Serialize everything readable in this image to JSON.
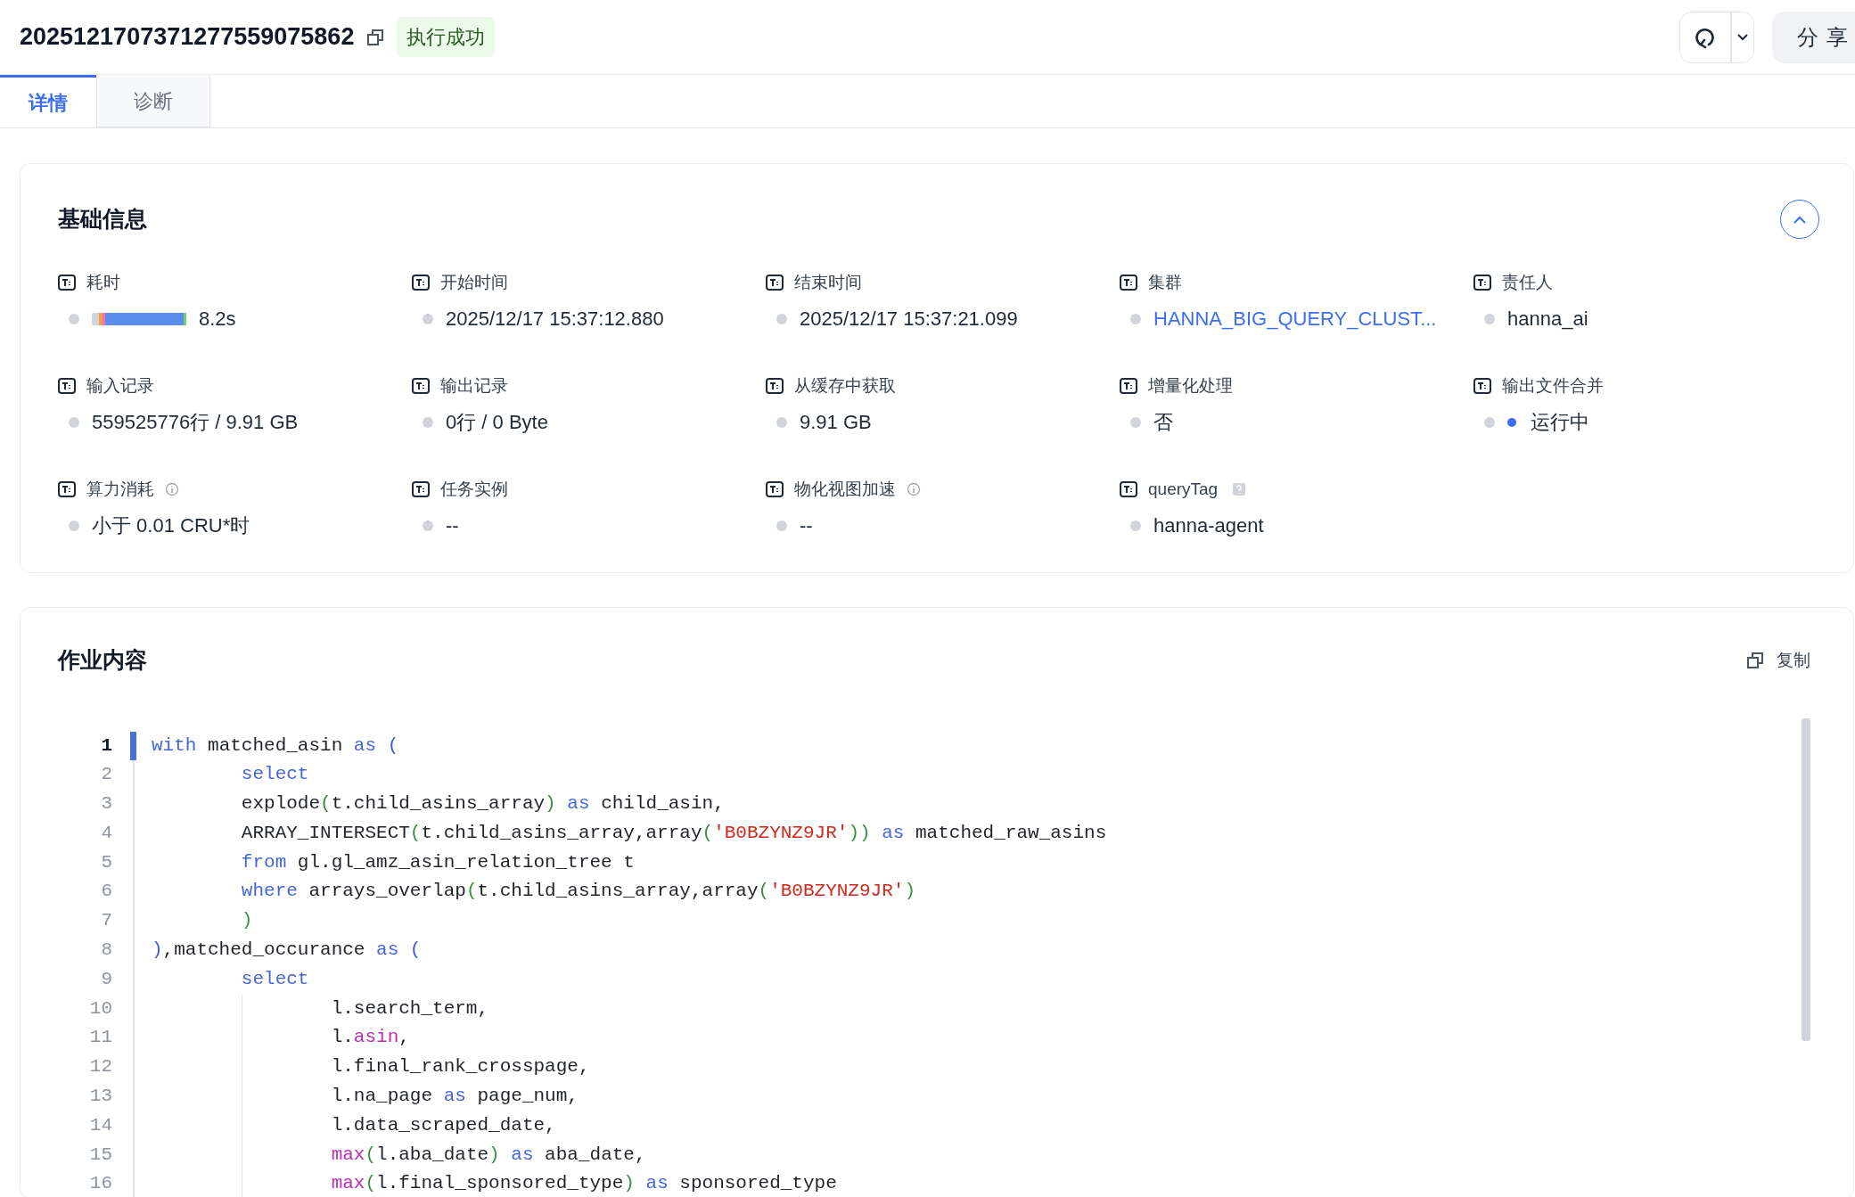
{
  "header": {
    "title": "2025121707371277559075862",
    "status_badge": "执行成功",
    "share_button": "分享"
  },
  "tabs": [
    {
      "label": "详情",
      "selected": true
    },
    {
      "label": "诊断",
      "selected": false
    }
  ],
  "basic_info": {
    "title": "基础信息",
    "expanded": true,
    "fields": [
      {
        "label": "耗时",
        "kind": "duration",
        "value": "8.2s"
      },
      {
        "label": "开始时间",
        "kind": "text",
        "value": "2025/12/17 15:37:12.880"
      },
      {
        "label": "结束时间",
        "kind": "text",
        "value": "2025/12/17 15:37:21.099"
      },
      {
        "label": "集群",
        "kind": "link",
        "value": "HANNA_BIG_QUERY_CLUST..."
      },
      {
        "label": "责任人",
        "kind": "text",
        "value": "hanna_ai"
      },
      {
        "label": "输入记录",
        "kind": "text",
        "value": "559525776行 / 9.91 GB"
      },
      {
        "label": "输出记录",
        "kind": "text",
        "value": "0行 / 0 Byte"
      },
      {
        "label": "从缓存中获取",
        "kind": "text",
        "value": "9.91 GB"
      },
      {
        "label": "增量化处理",
        "kind": "text",
        "value": "否"
      },
      {
        "label": "输出文件合并",
        "kind": "status",
        "value": "运行中"
      },
      {
        "label": "算力消耗",
        "kind": "text",
        "info_icon": true,
        "value": "小于 0.01 CRU*时"
      },
      {
        "label": "任务实例",
        "kind": "text",
        "value": "--"
      },
      {
        "label": "物化视图加速",
        "kind": "text",
        "info_icon": true,
        "value": "--"
      },
      {
        "label": "queryTag",
        "kind": "text",
        "help_icon": true,
        "value": "hanna-agent"
      }
    ]
  },
  "job_content": {
    "title": "作业内容",
    "copy_label": "复制",
    "code_lines": [
      {
        "number": "1",
        "selected": true,
        "tokens": [
          {
            "kind": "keyword",
            "text": "with"
          },
          {
            "kind": "plain",
            "text": " matched_asin"
          },
          {
            "kind": "keyword",
            "text": " as"
          },
          {
            "kind": "bracket",
            "text": " ("
          }
        ]
      },
      {
        "number": "2",
        "selected": false,
        "tokens": [
          {
            "kind": "keyword",
            "text": "\tselect"
          }
        ]
      },
      {
        "number": "3",
        "selected": false,
        "tokens": [
          {
            "kind": "plain",
            "text": "\texplode"
          },
          {
            "kind": "paren",
            "text": "("
          },
          {
            "kind": "plain",
            "text": "t.child_asins_array"
          },
          {
            "kind": "paren",
            "text": ")"
          },
          {
            "kind": "keyword",
            "text": " as"
          },
          {
            "kind": "plain",
            "text": " child_asin,"
          }
        ]
      },
      {
        "number": "4",
        "selected": false,
        "tokens": [
          {
            "kind": "plain",
            "text": "\tARRAY_INTERSECT"
          },
          {
            "kind": "paren",
            "text": "("
          },
          {
            "kind": "plain",
            "text": "t.child_asins_array,array"
          },
          {
            "kind": "paren",
            "text": "("
          },
          {
            "kind": "string",
            "text": "'B0BZYNZ9JR'"
          },
          {
            "kind": "paren",
            "text": "))"
          },
          {
            "kind": "keyword",
            "text": " as"
          },
          {
            "kind": "plain",
            "text": " matched_raw_asins"
          }
        ]
      },
      {
        "number": "5",
        "selected": false,
        "tokens": [
          {
            "kind": "keyword",
            "text": "\tfrom"
          },
          {
            "kind": "plain",
            "text": " gl.gl_amz_asin_relation_tree t"
          }
        ]
      },
      {
        "number": "6",
        "selected": false,
        "tokens": [
          {
            "kind": "keyword",
            "text": "\twhere"
          },
          {
            "kind": "plain",
            "text": " arrays_overlap"
          },
          {
            "kind": "paren",
            "text": "("
          },
          {
            "kind": "plain",
            "text": "t.child_asins_array,array"
          },
          {
            "kind": "paren",
            "text": "("
          },
          {
            "kind": "string",
            "text": "'B0BZYNZ9JR'"
          },
          {
            "kind": "paren",
            "text": ")"
          }
        ]
      },
      {
        "number": "7",
        "selected": false,
        "tokens": [
          {
            "kind": "paren",
            "text": "\t)"
          }
        ]
      },
      {
        "number": "8",
        "selected": false,
        "tokens": [
          {
            "kind": "bracket",
            "text": ")"
          },
          {
            "kind": "plain",
            "text": ",matched_occurance"
          },
          {
            "kind": "keyword",
            "text": " as"
          },
          {
            "kind": "bracket",
            "text": " ("
          }
        ]
      },
      {
        "number": "9",
        "selected": false,
        "tokens": [
          {
            "kind": "keyword",
            "text": "\tselect"
          }
        ]
      },
      {
        "number": "10",
        "selected": false,
        "tokens": [
          {
            "kind": "plain",
            "text": "\t\tl.search_term,"
          }
        ]
      },
      {
        "number": "11",
        "selected": false,
        "tokens": [
          {
            "kind": "plain",
            "text": "\t\tl."
          },
          {
            "kind": "builtin",
            "text": "asin"
          },
          {
            "kind": "plain",
            "text": ","
          }
        ]
      },
      {
        "number": "12",
        "selected": false,
        "tokens": [
          {
            "kind": "plain",
            "text": "\t\tl.final_rank_crosspage,"
          }
        ]
      },
      {
        "number": "13",
        "selected": false,
        "tokens": [
          {
            "kind": "plain",
            "text": "\t\tl.na_page"
          },
          {
            "kind": "keyword",
            "text": " as"
          },
          {
            "kind": "plain",
            "text": " page_num,"
          }
        ]
      },
      {
        "number": "14",
        "selected": false,
        "tokens": [
          {
            "kind": "plain",
            "text": "\t\tl.data_scraped_date,"
          }
        ]
      },
      {
        "number": "15",
        "selected": false,
        "tokens": [
          {
            "kind": "builtin",
            "text": "\t\tmax"
          },
          {
            "kind": "paren",
            "text": "("
          },
          {
            "kind": "plain",
            "text": "l.aba_date"
          },
          {
            "kind": "paren",
            "text": ")"
          },
          {
            "kind": "keyword",
            "text": " as"
          },
          {
            "kind": "plain",
            "text": " aba_date,"
          }
        ]
      },
      {
        "number": "16",
        "selected": false,
        "tokens": [
          {
            "kind": "builtin",
            "text": "\t\tmax"
          },
          {
            "kind": "paren",
            "text": "("
          },
          {
            "kind": "plain",
            "text": "l.final_sponsored_type"
          },
          {
            "kind": "paren",
            "text": ")"
          },
          {
            "kind": "keyword",
            "text": " as"
          },
          {
            "kind": "plain",
            "text": " sponsored_type"
          }
        ]
      }
    ]
  }
}
